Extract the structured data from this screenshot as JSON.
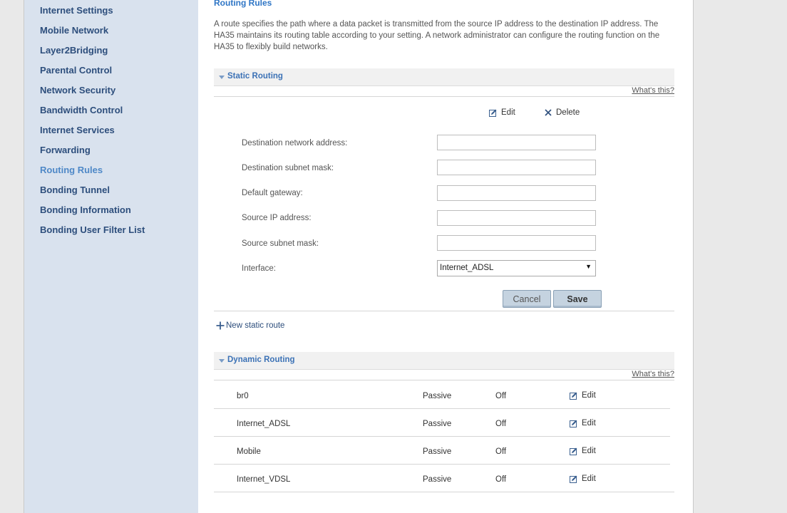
{
  "sidebar": {
    "items": [
      {
        "label": "Internet Settings"
      },
      {
        "label": "Mobile Network"
      },
      {
        "label": "Layer2Bridging"
      },
      {
        "label": "Parental Control"
      },
      {
        "label": "Network Security"
      },
      {
        "label": "Bandwidth Control"
      },
      {
        "label": "Internet Services"
      },
      {
        "label": "Forwarding"
      },
      {
        "label": "Routing Rules",
        "active": true
      },
      {
        "label": "Bonding Tunnel"
      },
      {
        "label": "Bonding Information"
      },
      {
        "label": "Bonding User Filter List"
      }
    ]
  },
  "page": {
    "title": "Routing Rules",
    "intro": "A route specifies the path where a data packet is transmitted from the source IP address to the destination IP address. The HA35 maintains its routing table according to your setting. A network administrator can configure the routing function on the HA35 to flexibly build networks."
  },
  "static_routing": {
    "title": "Static Routing",
    "whats_this": "What's this?",
    "edit_label": "Edit",
    "delete_label": "Delete",
    "fields": {
      "dest_addr": {
        "label": "Destination network address:",
        "value": ""
      },
      "dest_mask": {
        "label": "Destination subnet mask:",
        "value": ""
      },
      "gateway": {
        "label": "Default gateway:",
        "value": ""
      },
      "src_ip": {
        "label": "Source IP address:",
        "value": ""
      },
      "src_mask": {
        "label": "Source subnet mask:",
        "value": ""
      },
      "interface": {
        "label": "Interface:",
        "value": "Internet_ADSL"
      }
    },
    "cancel_label": "Cancel",
    "save_label": "Save",
    "new_route_label": "New static route"
  },
  "dynamic_routing": {
    "title": "Dynamic Routing",
    "whats_this": "What's this?",
    "edit_label": "Edit",
    "rows": [
      {
        "name": "br0",
        "mode": "Passive",
        "state": "Off"
      },
      {
        "name": "Internet_ADSL",
        "mode": "Passive",
        "state": "Off"
      },
      {
        "name": "Mobile",
        "mode": "Passive",
        "state": "Off"
      },
      {
        "name": "Internet_VDSL",
        "mode": "Passive",
        "state": "Off"
      }
    ]
  },
  "colors": {
    "sidebar_bg": "#d9e2ee",
    "nav_text": "#2d4e7c",
    "nav_active": "#4e88c7",
    "accent": "#3c72b6"
  }
}
